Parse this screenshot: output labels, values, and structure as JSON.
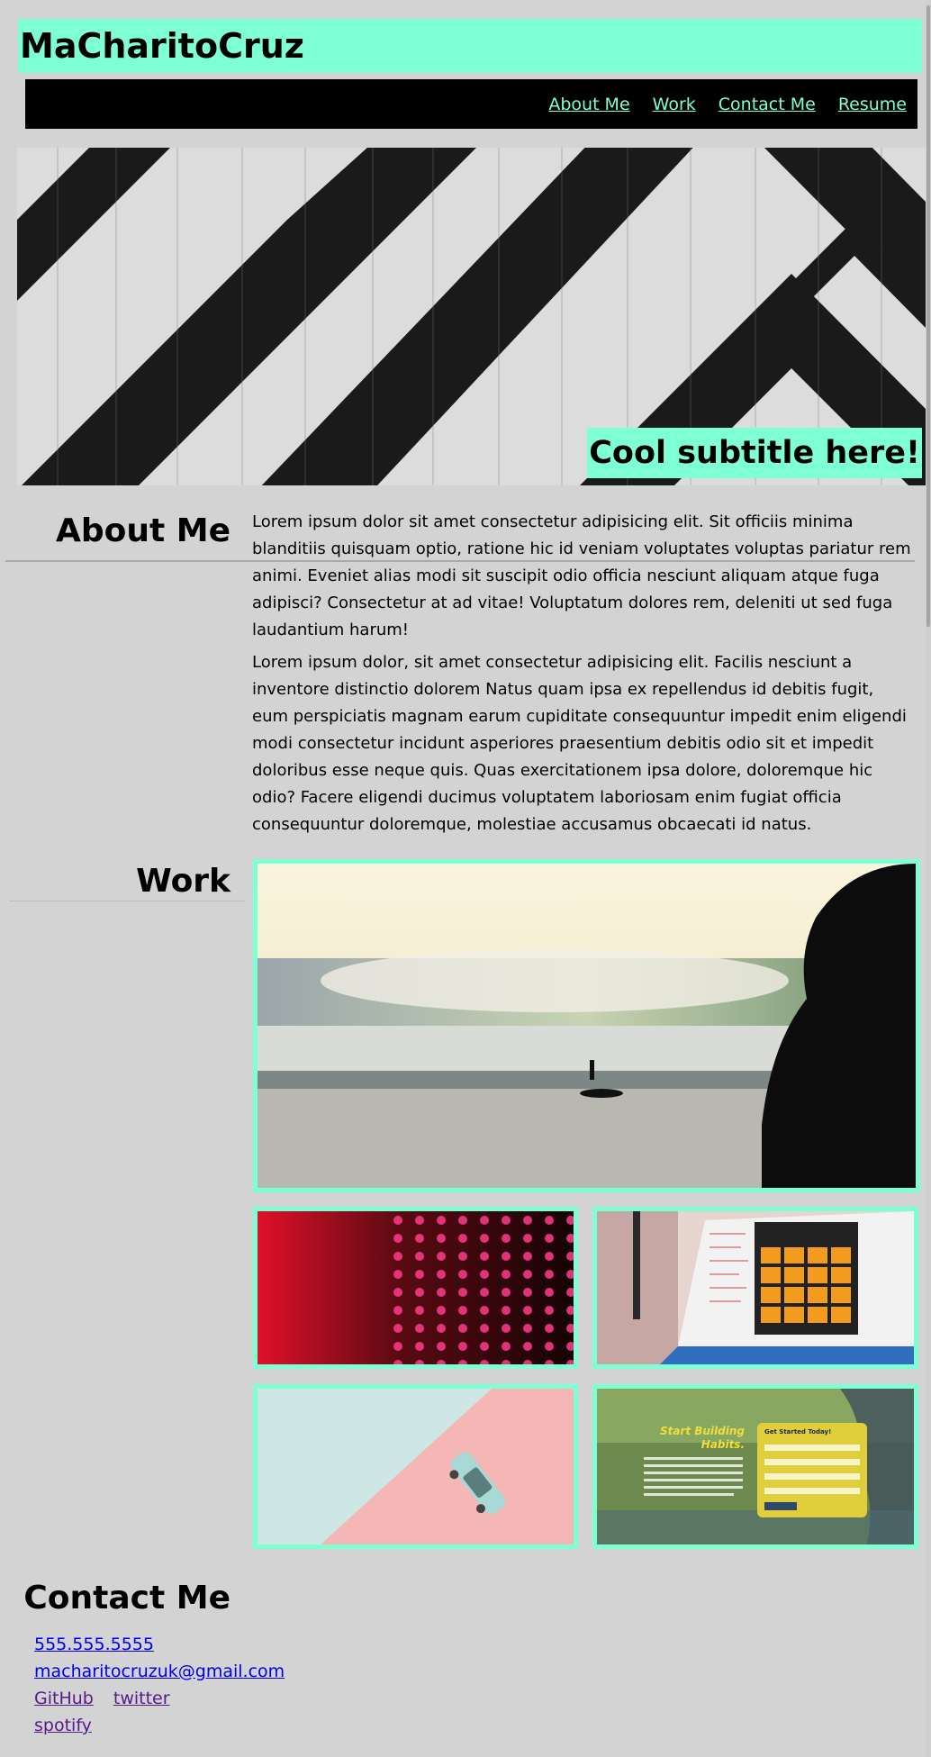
{
  "site": {
    "brand": "MaCharitoCruz"
  },
  "nav": {
    "items": [
      {
        "label": "About Me"
      },
      {
        "label": "Work"
      },
      {
        "label": "Contact Me"
      },
      {
        "label": "Resume"
      }
    ]
  },
  "hero": {
    "subtitle": "Cool subtitle here!"
  },
  "about": {
    "heading": "About Me",
    "paragraphs": [
      "Lorem ipsum dolor sit amet consectetur adipisicing elit. Sit officiis minima blanditiis quisquam optio, ratione hic id veniam voluptates voluptas pariatur rem animi. Eveniet alias modi sit suscipit odio officia nesciunt aliquam atque fuga adipisci? Consectetur at ad vitae! Voluptatum dolores rem, deleniti ut sed fuga laudantium harum!",
      "Lorem ipsum dolor, sit amet consectetur adipisicing elit. Facilis nesciunt a inventore distinctio dolorem Natus quam ipsa ex repellendus id debitis fugit, eum perspiciatis magnam earum cupiditate consequuntur impedit enim eligendi modi consectetur incidunt asperiores praesentium debitis odio sit et impedit doloribus esse neque quis. Quas exercitationem ipsa dolore, doloremque hic odio? Facere eligendi ducimus voluptatem laboriosam enim fugiat officia consequuntur doloremque, molestiae accusamus obcaecati id natus."
    ]
  },
  "work": {
    "heading": "Work",
    "thumb_habits": {
      "headline": "Start Building Habits.",
      "form_title": "Get Started Today!"
    }
  },
  "contact": {
    "heading": "Contact Me",
    "phone": "555.555.5555",
    "email": "macharitocruzuk@gmail.com",
    "links": [
      "GitHub",
      "twitter",
      "spotify"
    ]
  },
  "colors": {
    "accent": "#7fffd4",
    "background": "#d3d3d3",
    "nav_background": "#000000",
    "link": "#0000ee",
    "link_visited": "#551a8b"
  }
}
